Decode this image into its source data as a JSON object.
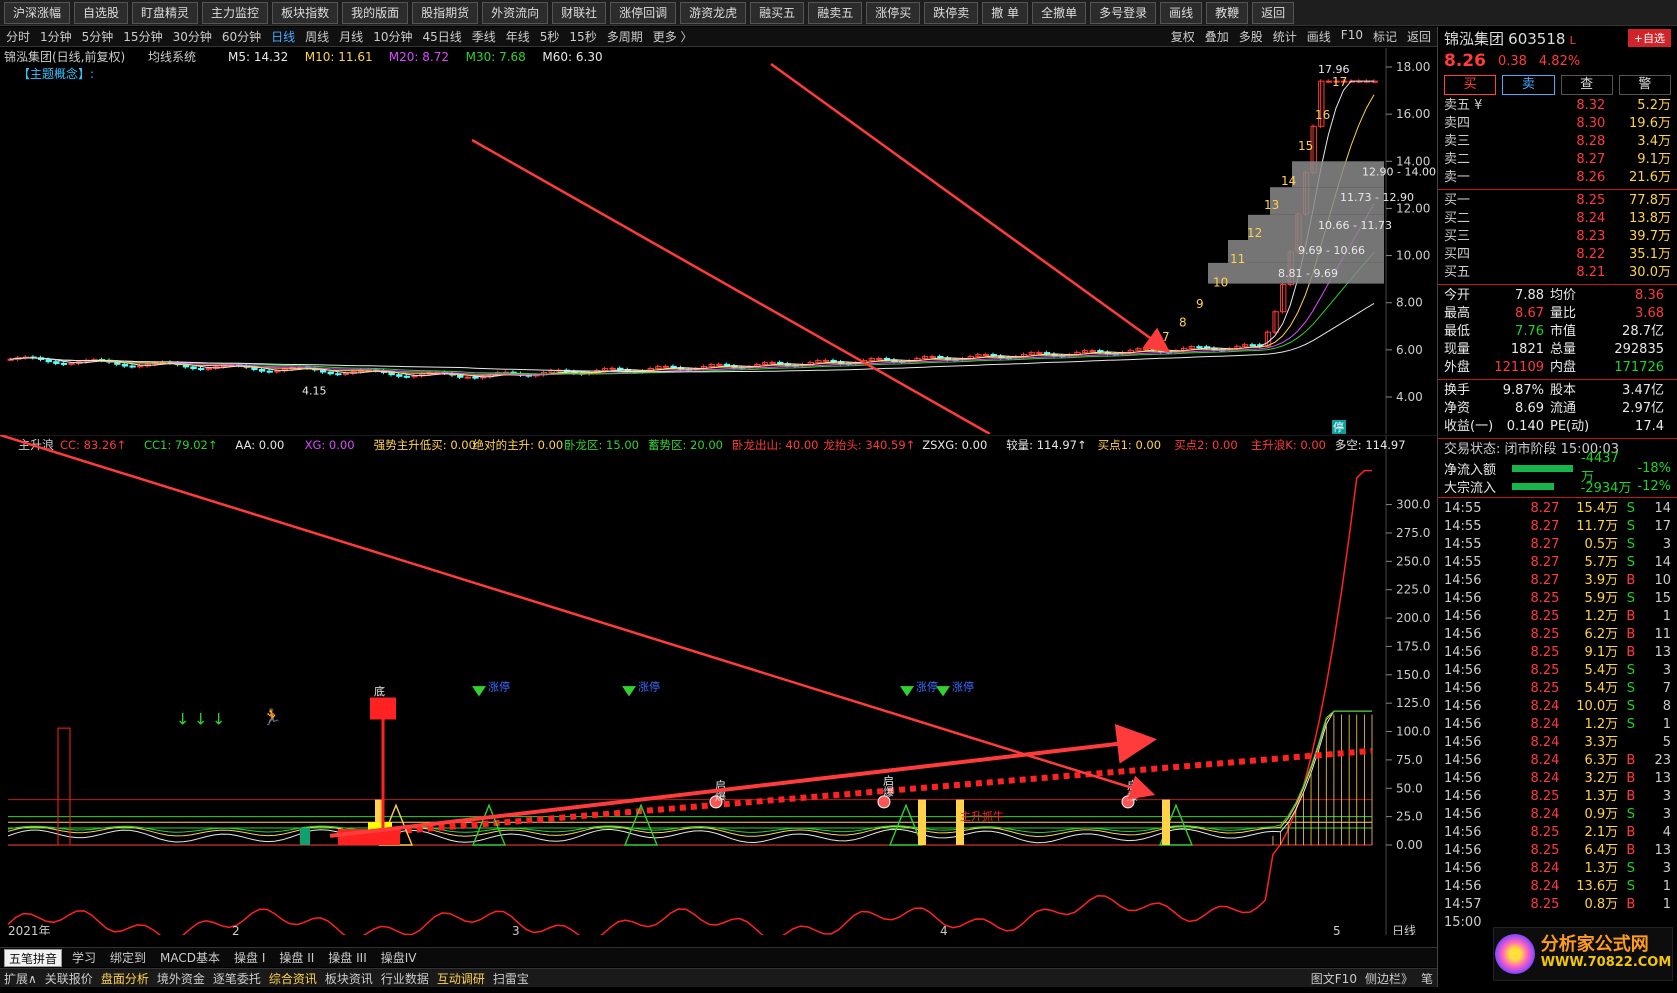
{
  "toolbar": {
    "buttons": [
      "沪深涨幅",
      "自选股",
      "盯盘精灵",
      "主力监控",
      "板块指数",
      "我的版面",
      "股指期货",
      "外资流向",
      "财联社",
      "涨停回调",
      "游资龙虎",
      "融买五",
      "融卖五",
      "涨停买",
      "跌停卖",
      "撤 单",
      "全撤单",
      "多号登录",
      "画线",
      "教鞭",
      "返回"
    ]
  },
  "periods": {
    "items": [
      "分时",
      "1分钟",
      "5分钟",
      "15分钟",
      "30分钟",
      "60分钟",
      "日线",
      "周线",
      "月线",
      "10分钟",
      "45日线",
      "季线",
      "年线",
      "5秒",
      "15秒",
      "多周期",
      "更多 〉"
    ],
    "active": "日线",
    "right": [
      "复权",
      "叠加",
      "多股",
      "统计",
      "画线",
      "F10",
      "标记",
      "返回"
    ]
  },
  "main": {
    "title": "锦泓集团(日线,前复权)",
    "indicator": "均线系统",
    "mas": [
      {
        "label": "M5: 14.32",
        "color": "#e8e8e8"
      },
      {
        "label": "M10: 11.61",
        "color": "#ffd24a"
      },
      {
        "label": "M20: 8.72",
        "color": "#d94bff"
      },
      {
        "label": "M30: 7.68",
        "color": "#2fd22f"
      },
      {
        "label": "M60: 6.30",
        "color": "#e8e8e8"
      }
    ],
    "concept": "【主题概念】:",
    "price_axis": [
      "18.00",
      "16.00",
      "14.00",
      "12.00",
      "10.00",
      "8.00",
      "6.00",
      "4.00"
    ],
    "high_label": "17.96",
    "low_label": "4.15",
    "stop_tag": "停",
    "boxes": [
      "12.90 - 14.00",
      "11.73 - 12.90",
      "10.66 - 11.73",
      "9.69 - 10.66",
      "8.81 - 9.69"
    ],
    "count_labels": [
      "7",
      "8",
      "9",
      "10",
      "11",
      "12",
      "13",
      "14",
      "15",
      "16",
      "17"
    ]
  },
  "ind": {
    "name": "主升浪",
    "params": [
      {
        "t": "CC: 83.26↑",
        "c": "#ff3b3b"
      },
      {
        "t": "CC1: 79.02↑",
        "c": "#2fd22f"
      },
      {
        "t": "AA: 0.00",
        "c": "#e8e8e8"
      },
      {
        "t": "XG: 0.00",
        "c": "#d94bff"
      },
      {
        "t": "强势主升低买: 0.00",
        "c": "#ffd24a"
      },
      {
        "t": "绝对的主升: 0.00",
        "c": "#ffd24a"
      },
      {
        "t": "卧龙区: 15.00",
        "c": "#2fd22f"
      },
      {
        "t": "蓄势区: 20.00",
        "c": "#2fd22f"
      },
      {
        "t": "卧龙出山: 40.00",
        "c": "#ff3b3b"
      },
      {
        "t": "龙抬头: 340.59↑",
        "c": "#ff3b3b"
      },
      {
        "t": "ZSXG: 0.00",
        "c": "#e8e8e8"
      },
      {
        "t": "较量: 114.97↑",
        "c": "#e8e8e8"
      },
      {
        "t": "买点1: 0.00",
        "c": "#ffd24a"
      },
      {
        "t": "买点2: 0.00",
        "c": "#ff3b3b"
      },
      {
        "t": "主升浪K: 0.00",
        "c": "#ff3b3b"
      },
      {
        "t": "多空: 114.97",
        "c": "#e8e8e8"
      }
    ],
    "axis": [
      "300.0",
      "275.0",
      "250.0",
      "225.0",
      "200.0",
      "175.0",
      "150.0",
      "125.0",
      "100.0",
      "75.0",
      "50.0",
      "25.0",
      "0.00"
    ],
    "qibao": "启爆",
    "zhangting": "涨停",
    "di": "底",
    "shengtext": "主升抓牛"
  },
  "xaxis": {
    "labels": [
      "2021年",
      "2",
      "3",
      "4",
      "5"
    ],
    "period": "日线"
  },
  "bottombar": {
    "ime": "五笔拼音",
    "tabs": [
      "学习",
      "绑定到",
      "MACD基本",
      "操盘 I",
      "操盘 II",
      "操盘 III",
      "操盘IV"
    ]
  },
  "statusbar": {
    "items": [
      "扩展∧",
      "关联报价",
      "盘面分析",
      "境外资金",
      "逐笔委托",
      "综合资讯",
      "板块资讯",
      "行业数据",
      "互动调研",
      "扫雷宝"
    ],
    "highlight": [
      "盘面分析",
      "综合资讯",
      "互动调研"
    ],
    "right": [
      "图文F10",
      "侧边栏》",
      "笔"
    ]
  },
  "quote": {
    "name": "锦泓集团",
    "code": "603518",
    "flag": "L",
    "add_btn": "+自选",
    "price": "8.26",
    "change": "0.38",
    "pct": "4.82%",
    "trade": [
      "买",
      "卖",
      "查",
      "警"
    ],
    "asks": [
      {
        "l": "卖五 ¥",
        "p": "8.32",
        "v": "5.2万"
      },
      {
        "l": "卖四",
        "p": "8.30",
        "v": "19.6万"
      },
      {
        "l": "卖三",
        "p": "8.28",
        "v": "3.4万"
      },
      {
        "l": "卖二",
        "p": "8.27",
        "v": "9.1万"
      },
      {
        "l": "卖一",
        "p": "8.26",
        "v": "21.6万"
      }
    ],
    "bids": [
      {
        "l": "买一",
        "p": "8.25",
        "v": "77.8万"
      },
      {
        "l": "买二",
        "p": "8.24",
        "v": "13.8万"
      },
      {
        "l": "买三",
        "p": "8.23",
        "v": "39.7万"
      },
      {
        "l": "买四",
        "p": "8.22",
        "v": "35.1万"
      },
      {
        "l": "买五",
        "p": "8.21",
        "v": "30.0万"
      }
    ],
    "stats": [
      {
        "a": "今开",
        "av": "7.88",
        "ac": "cw",
        "b": "均价",
        "bv": "8.36",
        "bc": "cr"
      },
      {
        "a": "最高",
        "av": "8.67",
        "ac": "cr",
        "b": "量比",
        "bv": "3.68",
        "bc": "cr"
      },
      {
        "a": "最低",
        "av": "7.76",
        "ac": "cg",
        "b": "市值",
        "bv": "28.7亿",
        "bc": "cw"
      },
      {
        "a": "现量",
        "av": "1821",
        "ac": "cw",
        "b": "总量",
        "bv": "292835",
        "bc": "cw"
      },
      {
        "a": "外盘",
        "av": "121109",
        "ac": "cr",
        "b": "内盘",
        "bv": "171726",
        "bc": "cg"
      }
    ],
    "stats2": [
      {
        "a": "换手",
        "av": "9.87%",
        "ac": "cw",
        "b": "股本",
        "bv": "3.47亿",
        "bc": "cw"
      },
      {
        "a": "净资",
        "av": "8.69",
        "ac": "cw",
        "b": "流通",
        "bv": "2.97亿",
        "bc": "cw"
      },
      {
        "a": "收益(一)",
        "av": "0.140",
        "ac": "cw",
        "b": "PE(动)",
        "bv": "17.4",
        "bc": "cw"
      }
    ],
    "state": "交易状态: 闭市阶段 15:00:03",
    "flows": [
      {
        "l": "净流入额",
        "v": "-4437万",
        "p": "-18%",
        "w": 62
      },
      {
        "l": "大宗流入",
        "v": "-2934万",
        "p": "-12%",
        "w": 42
      }
    ],
    "ticks": [
      [
        "14:55",
        "8.27",
        "15.4万",
        "S",
        "14"
      ],
      [
        "14:55",
        "8.27",
        "11.7万",
        "S",
        "17"
      ],
      [
        "14:55",
        "8.27",
        "0.5万",
        "S",
        "3"
      ],
      [
        "14:55",
        "8.27",
        "5.7万",
        "S",
        "14"
      ],
      [
        "14:56",
        "8.27",
        "3.9万",
        "B",
        "10"
      ],
      [
        "14:56",
        "8.25",
        "5.9万",
        "S",
        "15"
      ],
      [
        "14:56",
        "8.25",
        "1.2万",
        "B",
        "1"
      ],
      [
        "14:56",
        "8.25",
        "6.2万",
        "B",
        "11"
      ],
      [
        "14:56",
        "8.25",
        "9.1万",
        "B",
        "13"
      ],
      [
        "14:56",
        "8.25",
        "5.4万",
        "S",
        "3"
      ],
      [
        "14:56",
        "8.25",
        "5.4万",
        "S",
        "7"
      ],
      [
        "14:56",
        "8.24",
        "10.0万",
        "S",
        "8"
      ],
      [
        "14:56",
        "8.24",
        "1.2万",
        "S",
        "1"
      ],
      [
        "14:56",
        "8.24",
        "3.3万",
        "",
        "5"
      ],
      [
        "14:56",
        "8.24",
        "6.3万",
        "B",
        "23"
      ],
      [
        "14:56",
        "8.24",
        "3.2万",
        "B",
        "13"
      ],
      [
        "14:56",
        "8.25",
        "1.3万",
        "B",
        "3"
      ],
      [
        "14:56",
        "8.24",
        "0.9万",
        "S",
        "3"
      ],
      [
        "14:56",
        "8.25",
        "2.1万",
        "B",
        "4"
      ],
      [
        "14:56",
        "8.25",
        "6.4万",
        "B",
        "13"
      ],
      [
        "14:56",
        "8.24",
        "1.3万",
        "S",
        "3"
      ],
      [
        "14:56",
        "8.24",
        "13.6万",
        "S",
        "1"
      ],
      [
        "14:57",
        "8.25",
        "0.8万",
        "B",
        "1"
      ]
    ],
    "time_end": "15:00",
    "watermark": {
      "a": "分析家公式网",
      "b": "WWW.70822.COM"
    }
  }
}
